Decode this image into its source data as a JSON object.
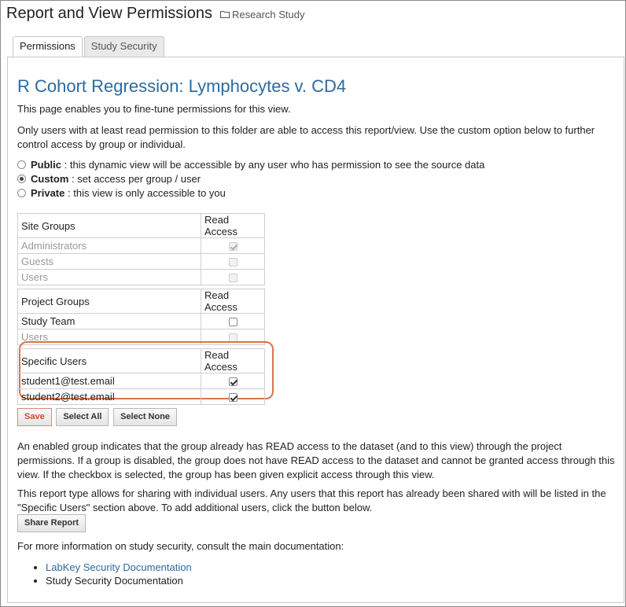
{
  "header": {
    "title": "Report and View Permissions",
    "folder": "Research Study"
  },
  "tabs": [
    {
      "label": "Permissions"
    },
    {
      "label": "Study Security"
    }
  ],
  "report": {
    "title": "R Cohort Regression: Lymphocytes v. CD4",
    "intro": "This page enables you to fine-tune permissions for this view.",
    "note": "Only users with at least read permission to this folder are able to access this report/view. Use the custom option below to further control access by group or individual."
  },
  "options": [
    {
      "name": "Public",
      "desc": ": this dynamic view will be accessible by any user who has permission to see the source data",
      "checked": false
    },
    {
      "name": "Custom",
      "desc": ": set access per group / user",
      "checked": true
    },
    {
      "name": "Private",
      "desc": ": this view is only accessible to you",
      "checked": false
    }
  ],
  "site_groups": {
    "header": "Site Groups",
    "access_header": "Read Access",
    "rows": [
      {
        "name": "Administrators",
        "checked": true,
        "disabled": true
      },
      {
        "name": "Guests",
        "checked": false,
        "disabled": true
      },
      {
        "name": "Users",
        "checked": false,
        "disabled": true
      }
    ]
  },
  "project_groups": {
    "header": "Project Groups",
    "access_header": "Read Access",
    "rows": [
      {
        "name": "Study Team",
        "checked": false,
        "disabled": false
      },
      {
        "name": "Users",
        "checked": false,
        "disabled": true
      }
    ]
  },
  "specific_users": {
    "header": "Specific Users",
    "access_header": "Read Access",
    "rows": [
      {
        "name": "student1@test.email",
        "checked": true,
        "disabled": false
      },
      {
        "name": "student2@test.email",
        "checked": true,
        "disabled": false
      }
    ]
  },
  "buttons": {
    "save": "Save",
    "select_all": "Select All",
    "select_none": "Select None",
    "share": "Share Report"
  },
  "info": {
    "enabled_group": "An enabled group indicates that the group already has READ access to the dataset (and to this view) through the project permissions. If a group is disabled, the group does not have READ access to the dataset and cannot be granted access through this view. If the checkbox is selected, the group has been given explicit access through this view.",
    "sharing": "This report type allows for sharing with individual users. Any users that this report has already been shared with will be listed in the \"Specific Users\" section above. To add additional users, click the button below.",
    "more": "For more information on study security, consult the main documentation:"
  },
  "doc_links": [
    {
      "label": "LabKey Security Documentation",
      "is_link": true
    },
    {
      "label": "Study Security Documentation",
      "is_link": false
    }
  ],
  "colors": {
    "title_blue": "#2c6aa0",
    "highlight": "#d9744a",
    "save_red": "#d14b2a"
  }
}
